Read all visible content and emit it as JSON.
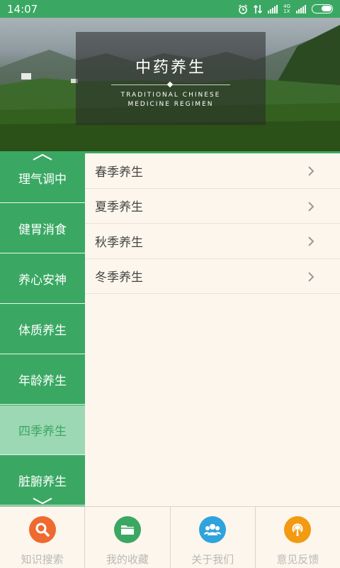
{
  "status_bar": {
    "time": "14:07",
    "network_top": "4G",
    "network_bottom": "1X"
  },
  "banner": {
    "title": "中药养生",
    "subtitle_line1": "TRADITIONAL CHINESE",
    "subtitle_line2": "MEDICINE REGIMEN"
  },
  "sidebar": {
    "items": [
      {
        "label": "理气调中"
      },
      {
        "label": "健胃消食"
      },
      {
        "label": "养心安神"
      },
      {
        "label": "体质养生"
      },
      {
        "label": "年龄养生"
      },
      {
        "label": "四季养生"
      },
      {
        "label": "脏腑养生"
      }
    ],
    "active": "四季养生"
  },
  "season_list": {
    "items": [
      {
        "label": "春季养生"
      },
      {
        "label": "夏季养生"
      },
      {
        "label": "秋季养生"
      },
      {
        "label": "冬季养生"
      }
    ]
  },
  "bottom_nav": {
    "items": [
      {
        "label": "知识搜索",
        "color": "#ee6a2f",
        "icon": "search-icon"
      },
      {
        "label": "我的收藏",
        "color": "#3aa863",
        "icon": "folder-icon"
      },
      {
        "label": "关于我们",
        "color": "#2fa3dd",
        "icon": "people-icon"
      },
      {
        "label": "意见反馈",
        "color": "#f29a12",
        "icon": "podcast-icon"
      }
    ]
  },
  "colors": {
    "primary": "#3aa863",
    "active_bg": "#9dd8b4",
    "background": "#fdf6ec"
  }
}
